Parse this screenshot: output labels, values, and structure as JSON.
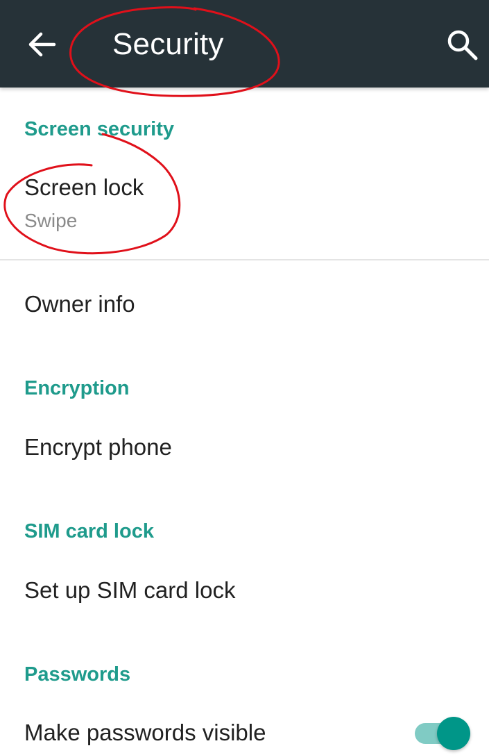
{
  "appbar": {
    "title": "Security",
    "back_icon": "arrow-left-icon",
    "search_icon": "search-icon",
    "background": "#263238"
  },
  "sections": [
    {
      "header": "Screen security",
      "items": [
        {
          "title": "Screen lock",
          "summary": "Swipe"
        },
        {
          "title": "Owner info"
        }
      ]
    },
    {
      "header": "Encryption",
      "items": [
        {
          "title": "Encrypt phone"
        }
      ]
    },
    {
      "header": "SIM card lock",
      "items": [
        {
          "title": "Set up SIM card lock"
        }
      ]
    },
    {
      "header": "Passwords",
      "items": [
        {
          "title": "Make passwords visible",
          "toggle_on": true
        }
      ]
    }
  ],
  "colors": {
    "accent": "#1f9b8c",
    "toggle_thumb": "#009688",
    "toggle_track": "#80cbc4",
    "annotation": "#e0101a"
  }
}
